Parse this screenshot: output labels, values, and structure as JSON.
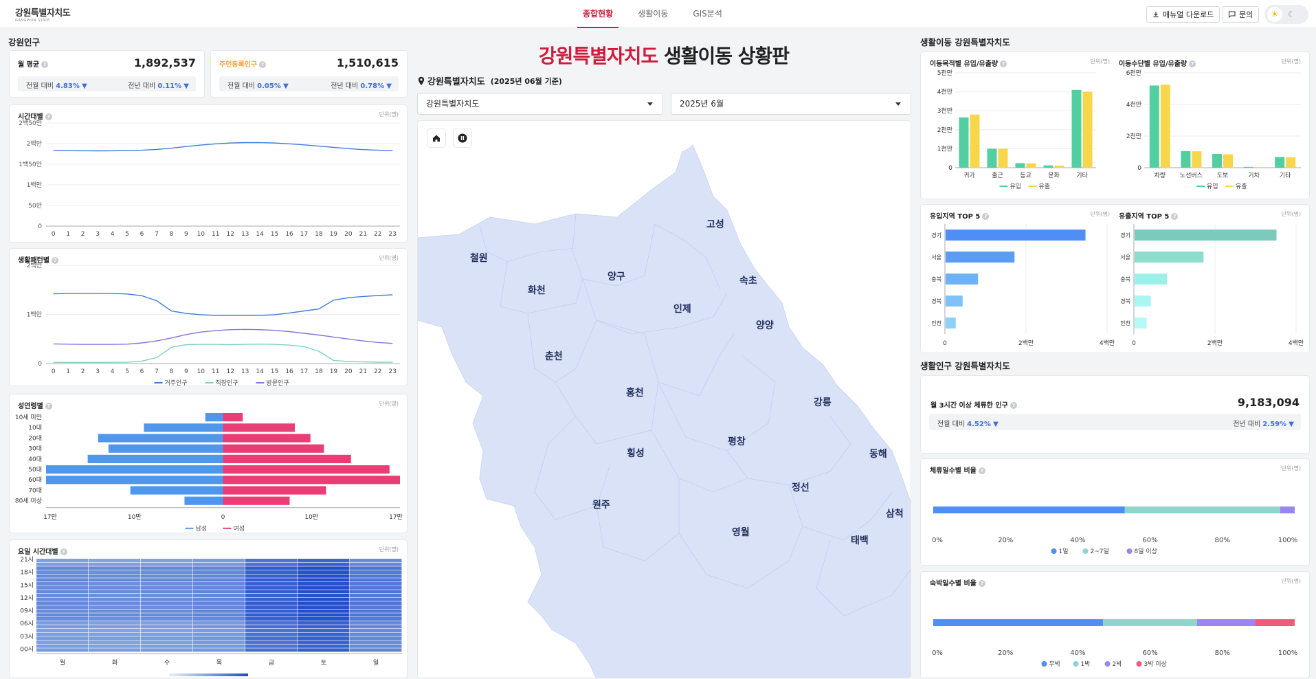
{
  "header": {
    "logo_text": "강원특별자치도",
    "logo_sub": "GANGWON STATE",
    "nav": [
      "종합현황",
      "생활이동",
      "GIS분석"
    ],
    "manual_btn": "매뉴얼 다운로드",
    "inquiry_btn": "문의"
  },
  "left": {
    "section_title": "강원인구",
    "kpi1": {
      "label": "월 평균",
      "value": "1,892,537",
      "mom_label": "전월 대비",
      "mom": "4.83%",
      "yoy_label": "전년 대비",
      "yoy": "0.11%"
    },
    "kpi2": {
      "label": "주민등록인구",
      "value": "1,510,615",
      "mom_label": "전월 대비",
      "mom": "0.05%",
      "yoy_label": "전년 대비",
      "yoy": "0.78%"
    },
    "hourly": {
      "title": "시간대별",
      "unit": "단위(명)"
    },
    "pattern": {
      "title": "생활패턴별",
      "unit": "단위(명)"
    },
    "agegender": {
      "title": "성연령별",
      "unit": "단위(명)"
    },
    "weekday": {
      "title": "요일 시간대별",
      "unit": "단위(명)"
    }
  },
  "center": {
    "title_red": "강원특별자치도",
    "title_rest": "생활이동 상황판",
    "location": "강원특별자치도",
    "period": "(2025년 06월 기준)",
    "region_select": "강원특별자치도",
    "month_select": "2025년 6월",
    "map_labels": [
      "고성",
      "철원",
      "화천",
      "양구",
      "속초",
      "인제",
      "양양",
      "춘천",
      "홍천",
      "강릉",
      "평창",
      "횡성",
      "동해",
      "정선",
      "원주",
      "삼척",
      "영월",
      "태백"
    ]
  },
  "right": {
    "section1": "생활이동 강원특별자치도",
    "purpose": {
      "title": "이동목적별 유입/유출량",
      "unit": "단위(명)"
    },
    "means": {
      "title": "이동수단별 유입/유출량",
      "unit": "단위(명)"
    },
    "in_top5": {
      "title": "유입지역 TOP 5",
      "unit": "단위(명)"
    },
    "out_top5": {
      "title": "유출지역 TOP 5",
      "unit": "단위(명)"
    },
    "section2": "생활인구 강원특별자치도",
    "stay": {
      "label": "월 3시간 이상 체류한 인구",
      "value": "9,183,094",
      "mom_label": "전월 대비",
      "mom": "4.52%",
      "yoy_label": "전년 대비",
      "yoy": "2.59%"
    },
    "stay_days": {
      "title": "체류일수별 비율",
      "unit": "단위(명)"
    },
    "nights": {
      "title": "숙박일수별 비율",
      "unit": "단위(명)"
    }
  },
  "chart_data": [
    {
      "type": "line",
      "id": "hourly",
      "x": [
        0,
        1,
        2,
        3,
        4,
        5,
        6,
        7,
        8,
        9,
        10,
        11,
        12,
        13,
        14,
        15,
        16,
        17,
        18,
        19,
        20,
        21,
        22,
        23
      ],
      "y_ticks": [
        "0",
        "50만",
        "1백만",
        "1백50만",
        "2백만",
        "2백50만"
      ],
      "ylim": [
        0,
        2500000
      ],
      "series": [
        {
          "name": "",
          "values": [
            1830000,
            1828000,
            1826000,
            1825000,
            1826000,
            1830000,
            1840000,
            1860000,
            1890000,
            1930000,
            1965000,
            1995000,
            2015000,
            2025000,
            2025000,
            2015000,
            1995000,
            1970000,
            1940000,
            1910000,
            1880000,
            1855000,
            1840000,
            1830000
          ]
        }
      ]
    },
    {
      "type": "line",
      "id": "pattern",
      "x": [
        0,
        1,
        2,
        3,
        4,
        5,
        6,
        7,
        8,
        9,
        10,
        11,
        12,
        13,
        14,
        15,
        16,
        17,
        18,
        19,
        20,
        21,
        22,
        23
      ],
      "y_ticks": [
        "0",
        "1백만",
        "2백만"
      ],
      "ylim": [
        0,
        2000000
      ],
      "series": [
        {
          "name": "거주인구",
          "color": "#3d7be0",
          "values": [
            1420000,
            1425000,
            1428000,
            1428000,
            1425000,
            1415000,
            1380000,
            1280000,
            1070000,
            1020000,
            995000,
            980000,
            975000,
            975000,
            980000,
            995000,
            1030000,
            1070000,
            1110000,
            1290000,
            1340000,
            1365000,
            1385000,
            1400000
          ]
        },
        {
          "name": "직장인구",
          "color": "#7fd0c4",
          "values": [
            25000,
            24000,
            24000,
            24000,
            25000,
            27000,
            50000,
            120000,
            330000,
            385000,
            390000,
            390000,
            385000,
            390000,
            395000,
            390000,
            375000,
            345000,
            250000,
            65000,
            40000,
            33000,
            28000,
            26000
          ]
        },
        {
          "name": "방문인구",
          "color": "#8a6fe0",
          "values": [
            400000,
            395000,
            390000,
            390000,
            390000,
            395000,
            420000,
            460000,
            520000,
            590000,
            640000,
            670000,
            690000,
            695000,
            690000,
            675000,
            650000,
            615000,
            580000,
            540000,
            500000,
            460000,
            430000,
            410000
          ]
        }
      ]
    },
    {
      "type": "bar",
      "id": "agegender",
      "categories": [
        "10세 미만",
        "10대",
        "20대",
        "30대",
        "40대",
        "50대",
        "60대",
        "70대",
        "80세 이상"
      ],
      "x_ticks": [
        "17만",
        "10만",
        "0",
        "10만",
        "17만"
      ],
      "xlim": [
        -170000,
        170000
      ],
      "series": [
        {
          "name": "남성",
          "color": "#4f97ec",
          "values": [
            17000,
            76000,
            120000,
            110000,
            130000,
            170000,
            170000,
            89000,
            37000
          ]
        },
        {
          "name": "여성",
          "color": "#e83e75",
          "values": [
            19000,
            69000,
            84000,
            97000,
            123000,
            160000,
            170000,
            99000,
            64000
          ]
        }
      ]
    },
    {
      "type": "heatmap",
      "id": "weekday",
      "x": [
        "월",
        "화",
        "수",
        "목",
        "금",
        "토",
        "일"
      ],
      "y_ticks": [
        "21시",
        "18시",
        "15시",
        "12시",
        "09시",
        "06시",
        "03시",
        "00시"
      ],
      "col_base": [
        0.45,
        0.43,
        0.44,
        0.48,
        0.78,
        0.9,
        0.6
      ]
    },
    {
      "type": "bar",
      "id": "purpose",
      "categories": [
        "귀가",
        "출근",
        "등교",
        "문화",
        "기타"
      ],
      "y_ticks": [
        "0",
        "1천만",
        "2천만",
        "3천만",
        "4천만",
        "5천만"
      ],
      "ylim": [
        0,
        5000000
      ],
      "series": [
        {
          "name": "유입",
          "color": "#52cfa0",
          "values": [
            2650000,
            1000000,
            240000,
            120000,
            4100000
          ]
        },
        {
          "name": "유출",
          "color": "#f8d64b",
          "values": [
            2800000,
            1000000,
            230000,
            110000,
            4000000
          ]
        }
      ]
    },
    {
      "type": "bar",
      "id": "means",
      "categories": [
        "차량",
        "노선버스",
        "도보",
        "기차",
        "기타"
      ],
      "y_ticks": [
        "0",
        "2천만",
        "4천만",
        "6천만"
      ],
      "ylim": [
        0,
        6000000
      ],
      "series": [
        {
          "name": "유입",
          "color": "#52cfa0",
          "values": [
            5200000,
            1050000,
            870000,
            50000,
            680000
          ]
        },
        {
          "name": "유출",
          "color": "#f8d64b",
          "values": [
            5250000,
            1040000,
            850000,
            40000,
            660000
          ]
        }
      ]
    },
    {
      "type": "bar",
      "id": "in_top5",
      "categories": [
        "경기",
        "서울",
        "충북",
        "경북",
        "인천"
      ],
      "x_ticks": [
        "0",
        "2백만",
        "4백만"
      ],
      "xlim": [
        0,
        4000000
      ],
      "colors": [
        "#4f8ef5",
        "#5d9cf5",
        "#6db1f7",
        "#7ec2f9",
        "#8dd1fb"
      ],
      "values": [
        3450000,
        1700000,
        800000,
        420000,
        250000
      ]
    },
    {
      "type": "bar",
      "id": "out_top5",
      "categories": [
        "경기",
        "서울",
        "충북",
        "경북",
        "인천"
      ],
      "x_ticks": [
        "0",
        "2백만",
        "4백만"
      ],
      "xlim": [
        0,
        4000000
      ],
      "colors": [
        "#7cc9be",
        "#8cdcd0",
        "#9cf0ea",
        "#aaf6f3",
        "#b5faf7"
      ],
      "values": [
        3500000,
        1700000,
        800000,
        400000,
        300000
      ]
    },
    {
      "type": "bar",
      "id": "stay_days",
      "orientation": "stacked-horizontal",
      "x_ticks": [
        "0%",
        "20%",
        "40%",
        "60%",
        "80%",
        "100%"
      ],
      "series": [
        {
          "name": "1일",
          "color": "#4f8ef5",
          "value": 53
        },
        {
          "name": "2~7일",
          "color": "#8fd5cb",
          "value": 43
        },
        {
          "name": "8일 이상",
          "color": "#9b85f3",
          "value": 4
        }
      ]
    },
    {
      "type": "bar",
      "id": "nights",
      "orientation": "stacked-horizontal",
      "x_ticks": [
        "0%",
        "20%",
        "40%",
        "60%",
        "80%",
        "100%"
      ],
      "series": [
        {
          "name": "무박",
          "color": "#4f8ef5",
          "value": 47
        },
        {
          "name": "1박",
          "color": "#8fd5cb",
          "value": 26
        },
        {
          "name": "2박",
          "color": "#9b85f3",
          "value": 16
        },
        {
          "name": "3박 이상",
          "color": "#ef5b7a",
          "value": 11
        }
      ]
    }
  ]
}
